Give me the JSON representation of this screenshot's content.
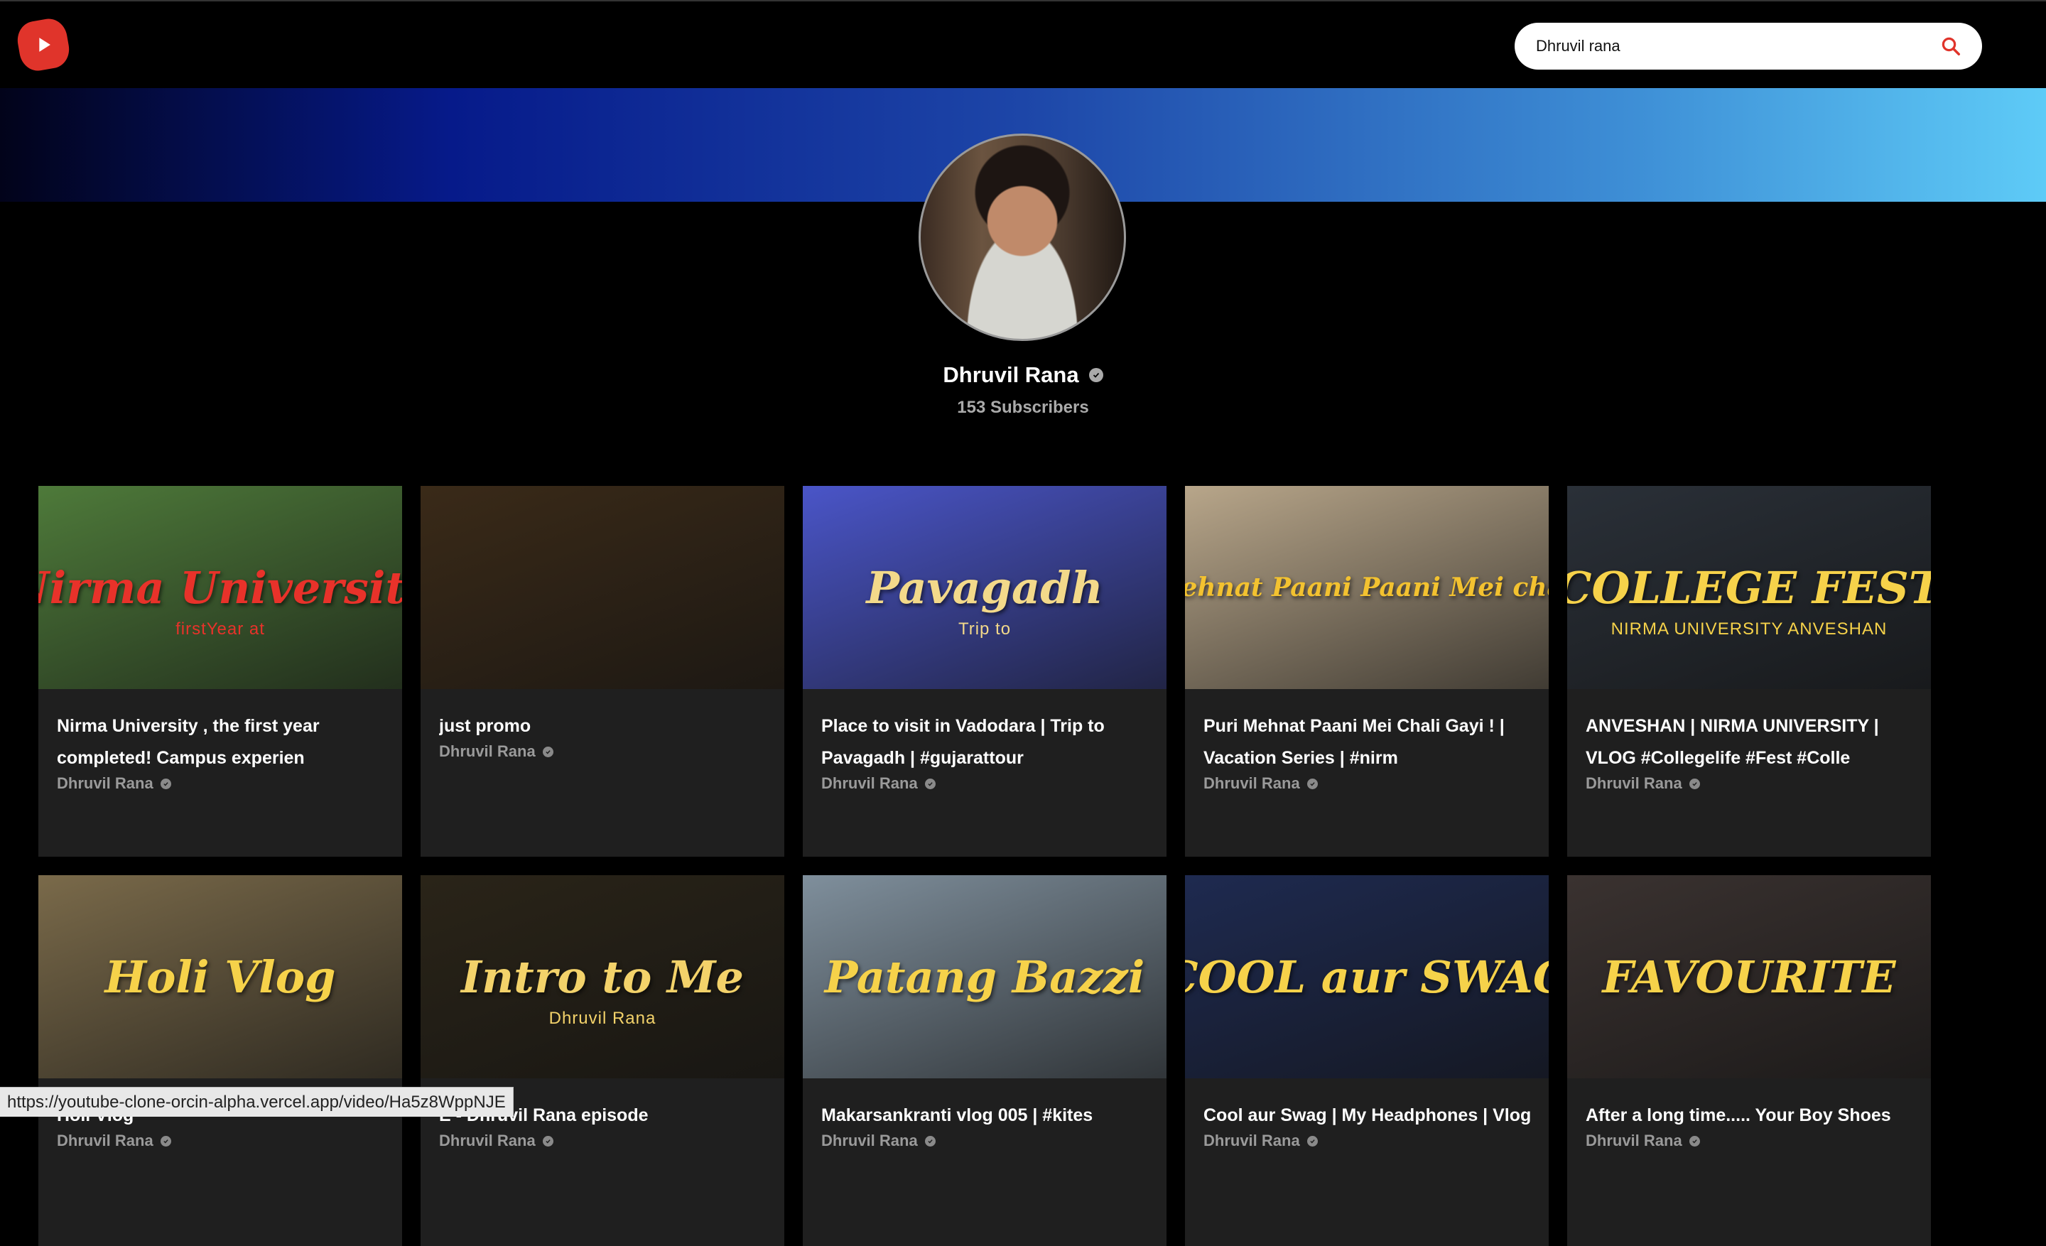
{
  "header": {
    "logo_icon": "play-logo-icon",
    "search": {
      "value": "Dhruvil rana",
      "icon": "search-icon"
    }
  },
  "channel": {
    "name": "Dhruvil Rana",
    "subscribers": "153 Subscribers"
  },
  "videos": [
    {
      "title": "Nirma University , the first year completed! Campus experien",
      "author": "Dhruvil Rana",
      "thumb_text": "Nirma University",
      "thumb_sub": "firstYear at",
      "thumb_bg": "#4e7a3a",
      "thumb_color": "#e8322a"
    },
    {
      "title": "just promo",
      "author": "Dhruvil Rana",
      "thumb_text": "",
      "thumb_sub": "",
      "thumb_bg": "#3a2a18",
      "thumb_color": "#ffffff"
    },
    {
      "title": "Place to visit in Vadodara | Trip to Pavagadh | #gujarattour",
      "author": "Dhruvil Rana",
      "thumb_text": "Pavagadh",
      "thumb_sub": "Trip to",
      "thumb_bg": "#4a55c8",
      "thumb_color": "#f3d98a"
    },
    {
      "title": "Puri Mehnat Paani Mei Chali Gayi ! | Vacation Series | #nirm",
      "author": "Dhruvil Rana",
      "thumb_text": "Puri Mehnat Paani Paani Mei chali gayi",
      "thumb_sub": "",
      "thumb_bg": "#b8a68a",
      "thumb_color": "#f3c230"
    },
    {
      "title": "ANVESHAN | NIRMA UNIVERSITY | VLOG #Collegelife #Fest #Colle",
      "author": "Dhruvil Rana",
      "thumb_text": "COLLEGE FEST",
      "thumb_sub": "NIRMA UNIVERSITY ANVESHAN",
      "thumb_bg": "#2a3038",
      "thumb_color": "#f6d24a"
    },
    {
      "title": "Holi Vlog",
      "author": "Dhruvil Rana",
      "thumb_text": "Holi     Vlog",
      "thumb_sub": "",
      "thumb_bg": "#7a6a4a",
      "thumb_color": "#f6d24a"
    },
    {
      "title": "E - Dhruvil Rana episode",
      "author": "Dhruvil Rana",
      "thumb_text": "Intro to Me",
      "thumb_sub": "Dhruvil Rana",
      "thumb_bg": "#2a2418",
      "thumb_color": "#f3d26a"
    },
    {
      "title": "Makarsankranti vlog 005 | #kites",
      "author": "Dhruvil Rana",
      "thumb_text": "Patang Bazzi",
      "thumb_sub": "",
      "thumb_bg": "#7f8f9c",
      "thumb_color": "#f6d24a"
    },
    {
      "title": "Cool aur Swag | My Headphones | Vlog",
      "author": "Dhruvil Rana",
      "thumb_text": "COOL aur SWAG",
      "thumb_sub": "",
      "thumb_bg": "#1e2a50",
      "thumb_color": "#f6d24a"
    },
    {
      "title": "After a long time..... Your Boy Shoes",
      "author": "Dhruvil Rana",
      "thumb_text": "FAVOURITE",
      "thumb_sub": "",
      "thumb_bg": "#3a3230",
      "thumb_color": "#f6d24a"
    }
  ],
  "status_bar": {
    "url": "https://youtube-clone-orcin-alpha.vercel.app/video/Ha5z8WppNJE"
  },
  "colors": {
    "accent": "#e0342b",
    "card_bg": "#1f1f1f",
    "muted": "#9a9a9a"
  }
}
